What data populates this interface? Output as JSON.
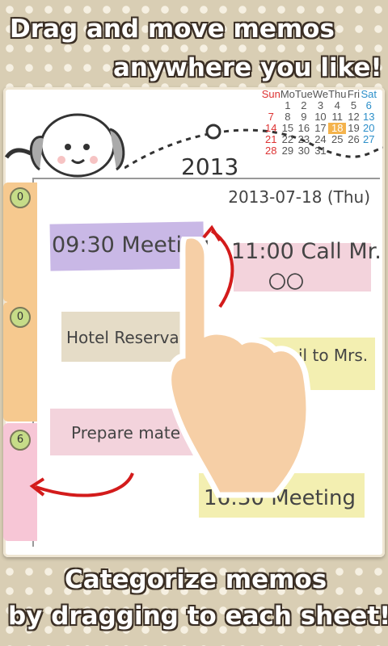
{
  "headlines": {
    "top_line1": "Drag and move memos",
    "top_line2": "anywhere you like!",
    "bottom_line1": "Categorize memos",
    "bottom_line2": "by dragging to each sheet!"
  },
  "calendar": {
    "headers": [
      "Sun",
      "Mo",
      "Tue",
      "We",
      "Thu",
      "Fri",
      "Sat"
    ],
    "rows": [
      [
        "",
        "1",
        "2",
        "3",
        "4",
        "5",
        "6"
      ],
      [
        "7",
        "8",
        "9",
        "10",
        "11",
        "12",
        "13"
      ],
      [
        "14",
        "15",
        "16",
        "17",
        "18",
        "19",
        "20"
      ],
      [
        "21",
        "22",
        "23",
        "24",
        "25",
        "26",
        "27"
      ],
      [
        "28",
        "29",
        "30",
        "31",
        "",
        "",
        ""
      ]
    ]
  },
  "year": "2013",
  "date": "2013-07-18 (Thu)",
  "sheets": [
    {
      "count": "0",
      "color": "#f6c98f"
    },
    {
      "count": "0",
      "color": "#f6c98f"
    },
    {
      "count": "6",
      "color": "#f7c6d6"
    }
  ],
  "memos": [
    {
      "text": "09:30 Meeting"
    },
    {
      "text": "11:00 Call Mr."
    },
    {
      "text": "〇〇"
    },
    {
      "text": "Hotel Reserva"
    },
    {
      "text": "il to Mrs."
    },
    {
      "text": "Prepare mate"
    },
    {
      "text": "16:30 Meeting"
    }
  ],
  "colors": {
    "tape_purple": "#c9b8e6",
    "tape_pink": "#f3d3dc",
    "tape_beige": "#e5dcc7",
    "tape_yellow": "#f3efb1",
    "arrow": "#d31b1b"
  }
}
